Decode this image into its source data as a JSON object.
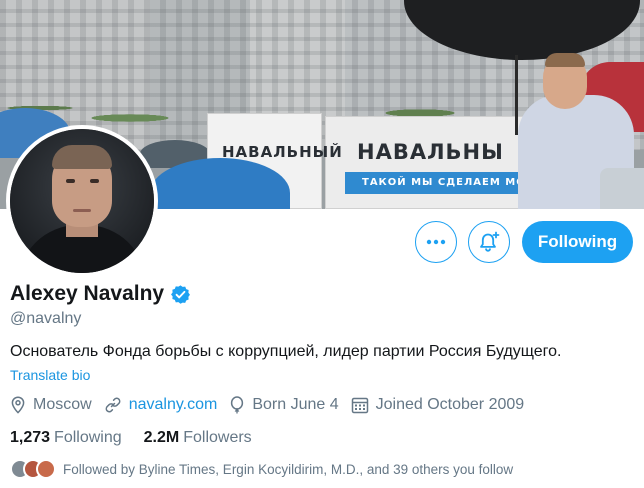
{
  "banner": {
    "sign_left": "НАВАЛЬНЫЙ",
    "sign_main": "НАВАЛЬНЫ",
    "sign_slogan": "ТАКОЙ МЫ СДЕЛАЕМ МОСК"
  },
  "actions": {
    "more_icon": "more-horizontal-icon",
    "notify_icon": "bell-plus-icon",
    "following_label": "Following"
  },
  "profile": {
    "name": "Alexey Navalny",
    "verified_icon": "verified-badge-icon",
    "handle": "@navalny",
    "bio": "Основатель Фонда борьбы с коррупцией, лидер партии Россия Будущего.",
    "translate_label": "Translate bio",
    "location": "Moscow",
    "website": "navalny.com",
    "birthday": "Born June 4",
    "joined": "Joined October 2009"
  },
  "stats": {
    "following_count": "1,273",
    "following_label": "Following",
    "followers_count": "2.2M",
    "followers_label": "Followers"
  },
  "followed_by": {
    "text": "Followed by Byline Times, Ergin Kocyildirim, M.D., and 39 others you follow"
  },
  "colors": {
    "accent": "#1da1f2",
    "link": "#1b95e0",
    "secondary_text": "#657786",
    "primary_text": "#14171a"
  }
}
